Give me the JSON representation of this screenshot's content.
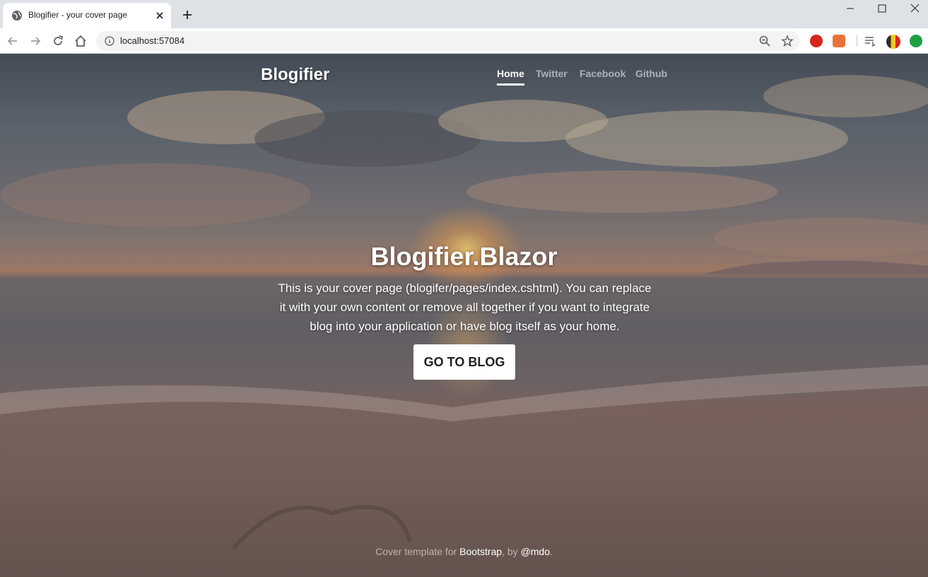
{
  "browser": {
    "tab_title": "Blogifier - your cover page",
    "url": "localhost:57084"
  },
  "site": {
    "brand": "Blogifier",
    "nav": [
      {
        "label": "Home",
        "active": true
      },
      {
        "label": "Twitter",
        "active": false
      },
      {
        "label": "Facebook",
        "active": false
      },
      {
        "label": "Github",
        "active": false
      }
    ],
    "hero_title": "Blogifier.Blazor",
    "lead": "This is your cover page (blogifer/pages/index.cshtml). You can replace it with your own content or remove all together if you want to integrate blog into your application or have blog itself as your home.",
    "cta_label": "GO TO BLOG",
    "footer": {
      "prefix": "Cover template for ",
      "link1": "Bootstrap",
      "middle": ", by ",
      "link2": "@mdo",
      "suffix": "."
    }
  },
  "icons": {
    "tab": "globe-icon",
    "close": "close-icon",
    "new_tab": "plus-icon",
    "back": "back-arrow-icon",
    "forward": "forward-arrow-icon",
    "reload": "reload-icon",
    "home": "home-icon",
    "info": "info-icon",
    "zoom": "zoom-icon",
    "bookmark": "star-icon"
  },
  "colors": {
    "chrome_bg": "#dee1e6",
    "cta_bg": "#ffffff",
    "text_light": "#ffffff"
  }
}
